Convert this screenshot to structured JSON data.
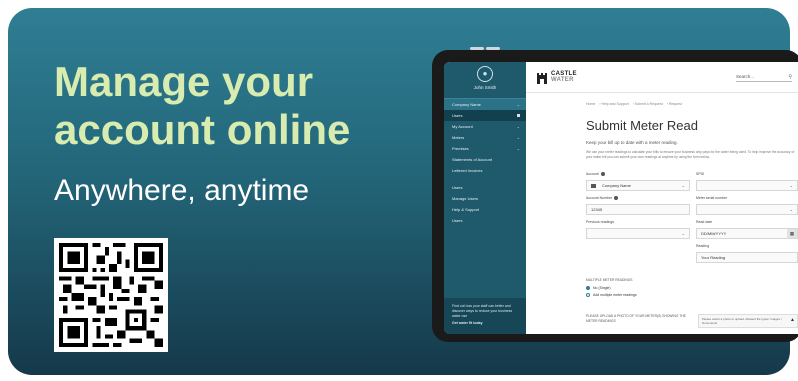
{
  "promo": {
    "headline_line1": "Manage your",
    "headline_line2": "account online",
    "subline": "Anywhere, anytime"
  },
  "colors": {
    "banner_top": "#2f7e94",
    "banner_bottom": "#15394a",
    "headline": "#d8ecb0",
    "sidebar": "#1f5a6c"
  },
  "app": {
    "sidebar": {
      "user_name": "John Smith",
      "company": "Company Name",
      "items": [
        "Users",
        "My Account",
        "Meters",
        "Premises",
        "Statements of Account",
        "Lettered Invoices",
        "Users",
        "Manage Users",
        "Help & Support",
        "Users"
      ],
      "footer_text": "Find out how your staff can better and discover ways to reduce your business water use",
      "footer_link": "Get water fit today"
    },
    "header": {
      "logo_line1": "CASTLE",
      "logo_line2": "WATER",
      "search_placeholder": "Search..."
    },
    "breadcrumbs": [
      "Home",
      "Help and Support",
      "Submit a Request",
      "Request"
    ],
    "page_title": "Submit Meter Read",
    "intro": "Keep your bill up to date with a meter reading.",
    "description": "We use your meter readings to calculate your bills to ensure your business only pays for the water being used. To help improve the accuracy of your water bill you can submit your own readings at anytime by using the form below.",
    "form": {
      "account_label": "Account",
      "account_value": "Company Name",
      "spid_label": "SPID",
      "account_number_label": "Account Number",
      "account_number_value": "12345",
      "meter_serial_label": "Meter serial number",
      "previous_readings_label": "Previous readings",
      "read_date_label": "Read date",
      "read_date_value": "DD/MM/YYYY",
      "reading_label": "Reading",
      "reading_placeholder": "Your Reading",
      "multiple_label": "MULTIPLE METER READINGS",
      "radio_single": "No (Single)",
      "radio_multiple": "Add multiple meter readings",
      "photo_text": "PLEASE UPLOAD A PHOTO OF YOUR METER(S) SHOWING THE METER READINGS",
      "upload_text": "Please select a photo to upload. Allowed file types: Images / Documents"
    }
  }
}
